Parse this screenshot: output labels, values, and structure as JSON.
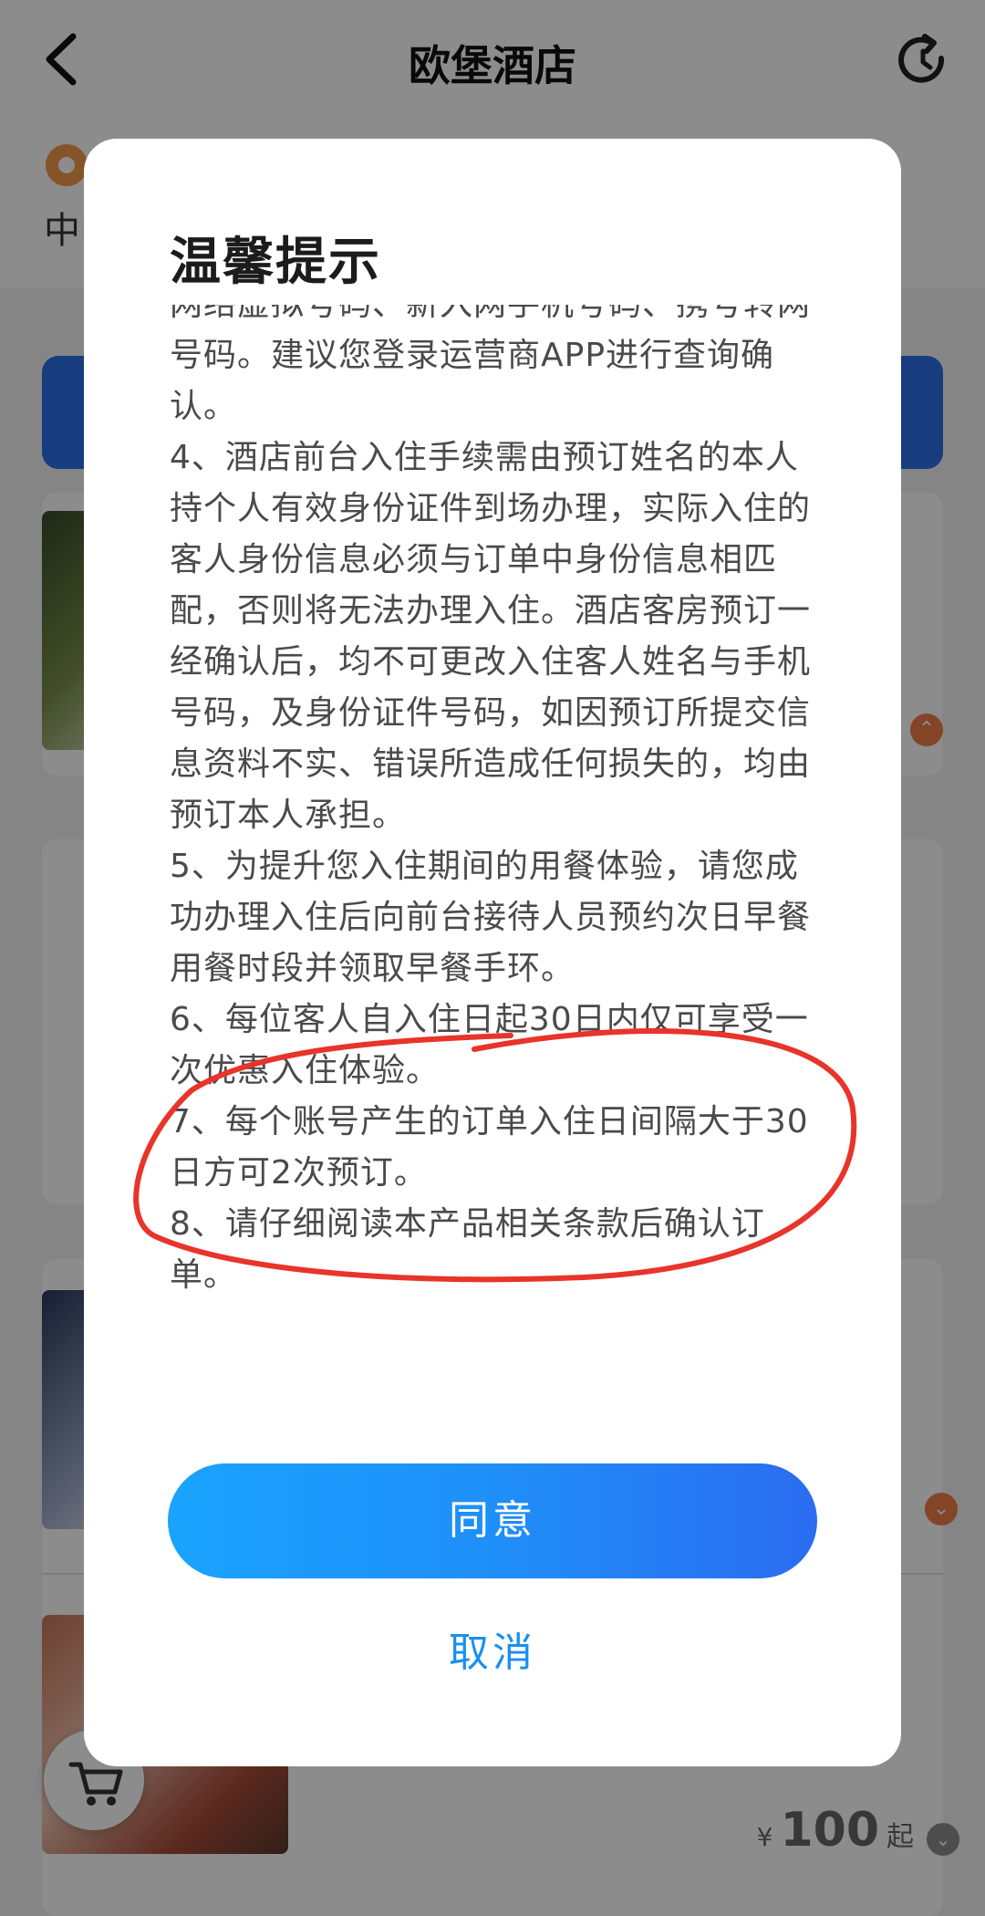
{
  "nav": {
    "title": "欧堡酒店",
    "back_icon": "chevron-left-icon",
    "refresh_icon": "refresh-icon"
  },
  "location": {
    "text": "中I"
  },
  "listing": {
    "price_currency": "¥",
    "price_value": "100",
    "price_suffix": "起"
  },
  "modal": {
    "title": "温馨提示",
    "paragraphs": [
      "网络虚拟号码、新入网手机号码、携号转网号码。建议您登录运营商APP进行查询确认。",
      "4、酒店前台入住手续需由预订姓名的本人持个人有效身份证件到场办理，实际入住的客人身份信息必须与订单中身份信息相匹配，否则将无法办理入住。酒店客房预订一经确认后，均不可更改入住客人姓名与手机号码，及身份证件号码，如因预订所提交信息资料不实、错误所造成任何损失的，均由预订本人承担。",
      "5、为提升您入住期间的用餐体验，请您成功办理入住后向前台接待人员预约次日早餐用餐时段并领取早餐手环。",
      "6、每位客人自入住日起30日内仅可享受一次优惠入住体验。",
      "7、每个账号产生的订单入住日间隔大于30日方可2次预订。",
      "8、请仔细阅读本产品相关条款后确认订单。"
    ],
    "agree_label": "同意",
    "cancel_label": "取消"
  },
  "colors": {
    "accent_blue": "#1a8ff0",
    "annotation_red": "#e8342a",
    "pin_orange": "#f39a4a"
  }
}
